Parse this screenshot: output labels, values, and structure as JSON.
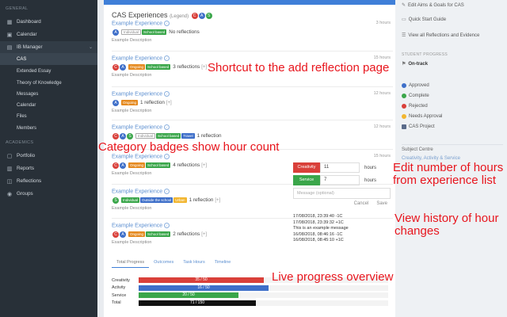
{
  "sidebar": {
    "sections": [
      "GENERAL",
      "ACADEMICS"
    ],
    "items": [
      {
        "label": "Dashboard",
        "icon": "dashboard-icon"
      },
      {
        "label": "Calendar",
        "icon": "calendar-icon"
      },
      {
        "label": "IB Manager",
        "icon": "folder-icon"
      },
      {
        "label": "CAS"
      },
      {
        "label": "Extended Essay"
      },
      {
        "label": "Theory of Knowledge"
      },
      {
        "label": "Messages"
      },
      {
        "label": "Calendar"
      },
      {
        "label": "Files"
      },
      {
        "label": "Members"
      },
      {
        "label": "Portfolio",
        "icon": "portfolio-icon"
      },
      {
        "label": "Reports",
        "icon": "reports-icon"
      },
      {
        "label": "Reflections",
        "icon": "reflections-icon"
      },
      {
        "label": "Groups",
        "icon": "groups-icon"
      }
    ]
  },
  "main": {
    "title": "CAS Experiences",
    "title_sub": "(Legend)",
    "legend": [
      "C",
      "A",
      "S"
    ],
    "experiences": [
      {
        "title": "Example Experience",
        "hours": "3 hours",
        "circles": [
          "A"
        ],
        "badges": [
          {
            "t": "Individual",
            "c": "grey"
          },
          {
            "t": "School based",
            "c": "green"
          }
        ],
        "reflections": "No reflections",
        "add": "",
        "desc": "Example Description"
      },
      {
        "title": "Example Experience",
        "hours": "15 hours",
        "circles": [
          "C",
          "A"
        ],
        "badges": [
          {
            "t": "Ongoing",
            "c": "orange"
          },
          {
            "t": "School based",
            "c": "green"
          }
        ],
        "reflections": "3 reflections",
        "add": "[+]",
        "desc": "Example Description"
      },
      {
        "title": "Example Experience",
        "hours": "12 hours",
        "circles": [
          "A"
        ],
        "badges": [
          {
            "t": "Ongoing",
            "c": "orange"
          }
        ],
        "reflections": "1 reflection",
        "add": "[+]",
        "desc": "Example Description"
      },
      {
        "title": "Example Experience",
        "hours": "12 hours",
        "circles": [
          "C",
          "A",
          "S"
        ],
        "badges": [
          {
            "t": "Individual",
            "c": "grey"
          },
          {
            "t": "School based",
            "c": "green"
          },
          {
            "t": "Travel",
            "c": "blue"
          }
        ],
        "reflections": "1 reflection",
        "add": "",
        "desc": ""
      },
      {
        "title": "Example Experience",
        "hours": "15 hours",
        "circles": [
          "C",
          "A"
        ],
        "badges": [
          {
            "t": "Ongoing",
            "c": "orange"
          },
          {
            "t": "School based",
            "c": "green"
          }
        ],
        "reflections": "4 reflections",
        "add": "[+]",
        "desc": "Example Description"
      },
      {
        "title": "Example Experience",
        "hours": "",
        "circles": [
          "S"
        ],
        "badges": [
          {
            "t": "Individual",
            "c": "green"
          },
          {
            "t": "Outside the school",
            "c": "blue"
          },
          {
            "t": "Urban",
            "c": "yellow"
          }
        ],
        "reflections": "1 reflection",
        "add": "[+]",
        "desc": "Example Description"
      },
      {
        "title": "Example Experience",
        "hours": "",
        "circles": [
          "C",
          "A"
        ],
        "badges": [
          {
            "t": "Ongoing",
            "c": "orange"
          },
          {
            "t": "School based",
            "c": "green"
          }
        ],
        "reflections": "2 reflections",
        "add": "[+]",
        "desc": "Example Description"
      }
    ],
    "edit": {
      "rows": [
        {
          "tag": "Creativity",
          "value": "11",
          "unit": "hours",
          "color": "#d9403a"
        },
        {
          "tag": "Service",
          "value": "7",
          "unit": "hours",
          "color": "#3aa64a"
        }
      ],
      "message_placeholder": "Message (optional)",
      "cancel": "Cancel",
      "save": "Save"
    },
    "history": [
      "17/08/2018, 23:39:40 -1C",
      "17/08/2018, 23:39:32 +1C",
      "This is an example message",
      "16/08/2018, 08:46:16 -1C",
      "16/08/2018, 08:45:10 +1C"
    ],
    "tabs": [
      "Total Progress",
      "Outcomes",
      "Task Hours",
      "Timeline"
    ],
    "progress": [
      {
        "label": "Creativity",
        "text": "35 / 50",
        "fraction": 0.5,
        "color": "#d9403a"
      },
      {
        "label": "Activity",
        "text": "16 / 50",
        "fraction": 0.52,
        "color": "#3e6fc9"
      },
      {
        "label": "Service",
        "text": "20 / 50",
        "fraction": 0.4,
        "color": "#3aa64a"
      },
      {
        "label": "Total",
        "text": "71 / 150",
        "fraction": 0.47,
        "color": "#111111"
      }
    ]
  },
  "rpanel": {
    "links": [
      {
        "label": "Edit Aims & Goals for CAS",
        "icon": "pencil-icon"
      },
      {
        "label": "Quick Start Guide",
        "icon": "book-icon"
      },
      {
        "label": "View all Reflections and Evidence",
        "icon": "list-icon"
      }
    ],
    "progress_head": "STUDENT PROGRESS",
    "status": "On-track",
    "legend": [
      {
        "label": "Approved",
        "color": "#3e6fc9"
      },
      {
        "label": "Complete",
        "color": "#3aa64a"
      },
      {
        "label": "Rejected",
        "color": "#d9403a"
      },
      {
        "label": "Needs Approval",
        "color": "#f2b630"
      },
      {
        "label": "CAS Project",
        "color": "#5a6b8a"
      }
    ],
    "subject_centre": "Subject Centre",
    "subject_item": "Creativity, Activity & Service"
  },
  "annotations": [
    "Shortcut to the add reflection page",
    "Category badges show hour count",
    "Edit number of hours from experience list",
    "View history of hour changes",
    "Live progress overview"
  ]
}
